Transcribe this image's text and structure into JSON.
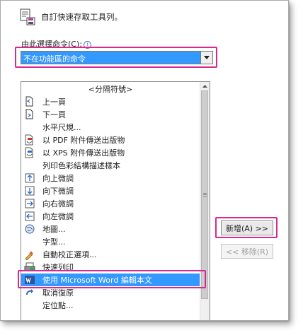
{
  "header": {
    "title": "自訂快速存取工具列。",
    "icon": "quick-access-toolbar-icon"
  },
  "choose": {
    "label": "由此選擇命令(C):",
    "value": "不在功能區的命令",
    "info_icon": "info-icon"
  },
  "commands": [
    {
      "label": "<分隔符號>",
      "icon": ""
    },
    {
      "label": "上一頁",
      "icon": "previous-page-icon"
    },
    {
      "label": "下一頁",
      "icon": "next-page-icon"
    },
    {
      "label": "水平尺規...",
      "icon": ""
    },
    {
      "label": "以 PDF 附件傳送出版物",
      "icon": "pdf-attachment-icon"
    },
    {
      "label": "以 XPS 附件傳送出版物",
      "icon": "xps-attachment-icon"
    },
    {
      "label": "列印色彩結構描述樣本",
      "icon": ""
    },
    {
      "label": "向上微調",
      "icon": "nudge-up-icon"
    },
    {
      "label": "向下微調",
      "icon": "nudge-down-icon"
    },
    {
      "label": "向右微調",
      "icon": "nudge-right-icon"
    },
    {
      "label": "向左微調",
      "icon": "nudge-left-icon"
    },
    {
      "label": "地圖...",
      "icon": "map-icon"
    },
    {
      "label": "字型...",
      "icon": ""
    },
    {
      "label": "自動校正選項...",
      "icon": "autocorrect-icon"
    },
    {
      "label": "快速列印",
      "icon": "quick-print-icon"
    },
    {
      "label": "使用 Microsoft Word 編輯本文",
      "icon": "word-edit-icon"
    },
    {
      "label": "取消復原",
      "icon": "redo-icon"
    },
    {
      "label": "定位點...",
      "icon": ""
    }
  ],
  "selected_index": 15,
  "buttons": {
    "add": "新增(A) >>",
    "remove": "<< 移除(R)"
  },
  "colors": {
    "highlight": "#d62a8f",
    "selection": "#3399ff"
  }
}
